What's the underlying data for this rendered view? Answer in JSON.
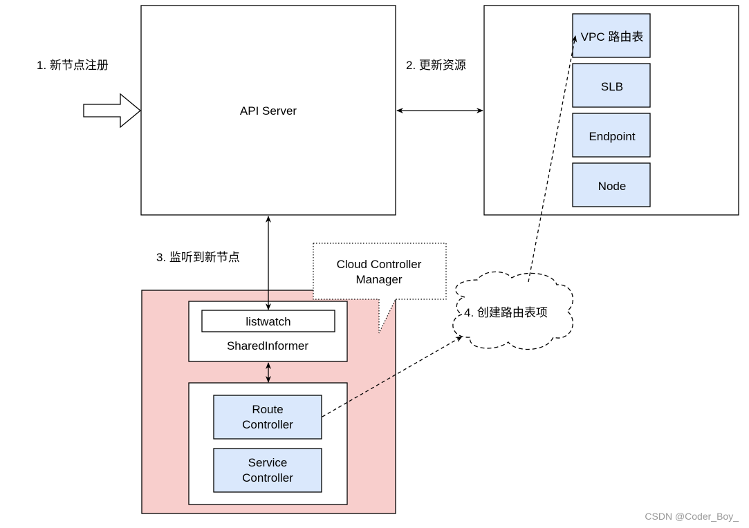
{
  "labels": {
    "step1": "1. 新节点注册",
    "step2": "2. 更新资源",
    "step3": "3. 监听到新节点",
    "step4": "4. 创建路由表项"
  },
  "api_server": {
    "title": "API Server"
  },
  "cloud_resources": {
    "items": [
      "VPC 路由表",
      "SLB",
      "Endpoint",
      "Node"
    ]
  },
  "ccm": {
    "callout_line1": "Cloud Controller",
    "callout_line2": "Manager",
    "informer": {
      "listwatch": "listwatch",
      "title": "SharedInformer"
    },
    "controllers": [
      {
        "line1": "Route",
        "line2": "Controller"
      },
      {
        "line1": "Service",
        "line2": "Controller"
      }
    ]
  },
  "watermark": "CSDN @Coder_Boy_",
  "colors": {
    "ccm_fill": "#f8cecc",
    "resource_fill": "#dae8fc",
    "stroke": "#000000"
  }
}
